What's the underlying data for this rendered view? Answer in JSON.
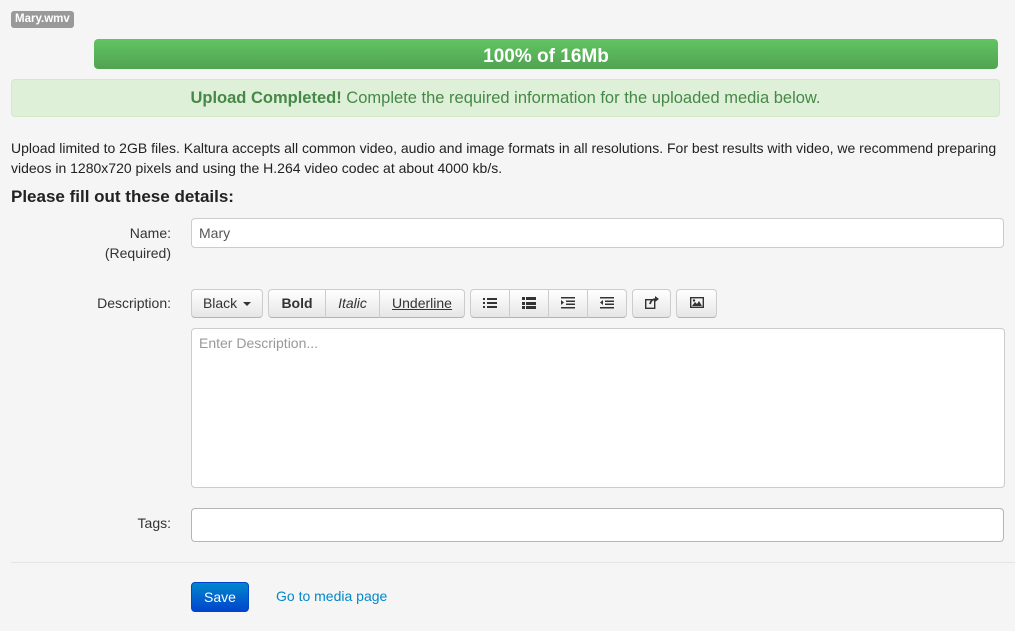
{
  "file": {
    "name": "Mary.wmv"
  },
  "progress": {
    "percent": 100,
    "label": "100% of 16Mb",
    "color": "#5eb95e"
  },
  "alert": {
    "strong": "Upload Completed!",
    "text": " Complete the required information for the uploaded media below.",
    "color": "#468847"
  },
  "info_text": "Upload limited to 2GB files. Kaltura accepts all common video, audio and image formats in all resolutions. For best results with video, we recommend preparing videos in 1280x720 pixels and using the H.264 video codec at about 4000 kb/s.",
  "form": {
    "heading": "Please fill out these details:",
    "name_label": "Name:",
    "name_required": "(Required)",
    "name_value": "Mary",
    "description_label": "Description:",
    "description_placeholder": "Enter Description...",
    "tags_label": "Tags:",
    "tags_value": ""
  },
  "toolbar": {
    "color_label": "Black",
    "bold": "Bold",
    "italic": "Italic",
    "underline": "Underline",
    "icons": [
      "unordered-list-icon",
      "ordered-list-icon",
      "indent-icon",
      "outdent-icon",
      "link-icon",
      "image-icon"
    ]
  },
  "actions": {
    "save": "Save",
    "go_to_media": "Go to media page"
  }
}
